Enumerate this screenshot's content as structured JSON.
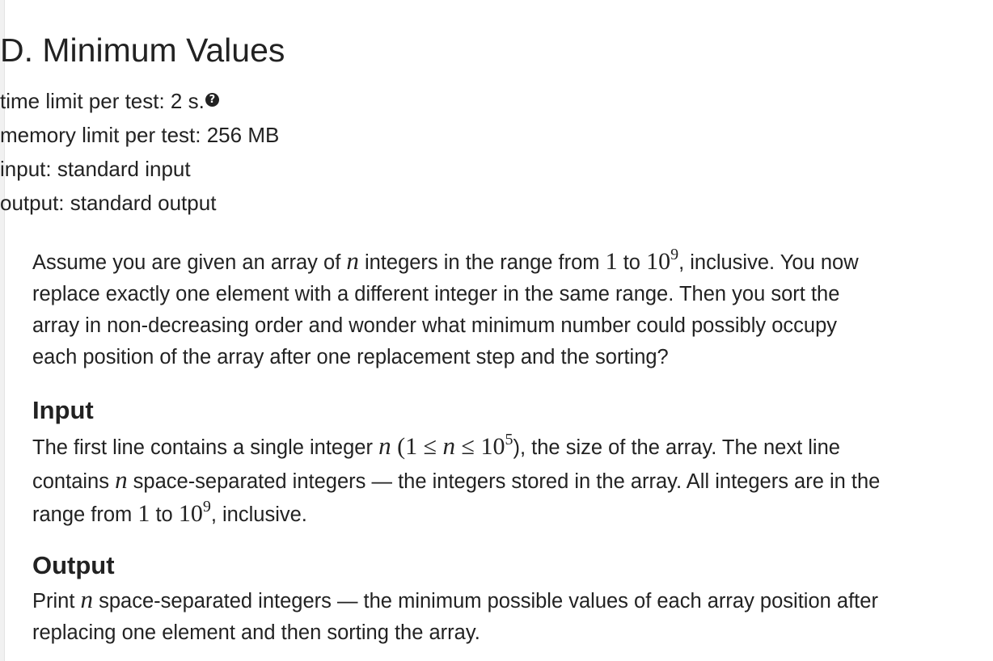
{
  "problem": {
    "title": "D. Minimum Values",
    "time_limit": "time limit per test: 2 s.",
    "help_icon_symbol": "?",
    "memory_limit": "memory limit per test: 256 MB",
    "input_file": "input: standard input",
    "output_file": "output: standard output"
  },
  "statement": {
    "p1": "Assume you are given an array of ",
    "var_n": "n",
    "p2": " integers in the range from ",
    "one": "1",
    "to": " to ",
    "ten": "10",
    "exp9": "9",
    "p3": ", inclusive. You now",
    "line2": "replace exactly one element with a different integer in the same range. Then you sort the",
    "line3": "array in non-decreasing order and wonder what minimum number could possibly occupy",
    "line4": "each position of the array after one replacement step and the sorting?"
  },
  "input_section": {
    "heading": "Input",
    "t1": "The first line contains a single integer ",
    "var_n": "n",
    "open": " (",
    "one": "1",
    "leq": " ≤ ",
    "ten": "10",
    "exp5": "5",
    "t2": "), the size of the array. The next line",
    "t3": "contains ",
    "t4": " space-separated integers — the integers stored in the array. All integers are in the",
    "t5": "range from ",
    "to": " to ",
    "exp9": "9",
    "t6": ", inclusive."
  },
  "output_section": {
    "heading": "Output",
    "t1": "Print ",
    "var_n": "n",
    "t2": " space-separated integers — the minimum possible values of each array position after",
    "t3": "replacing one element and then sorting the array."
  }
}
